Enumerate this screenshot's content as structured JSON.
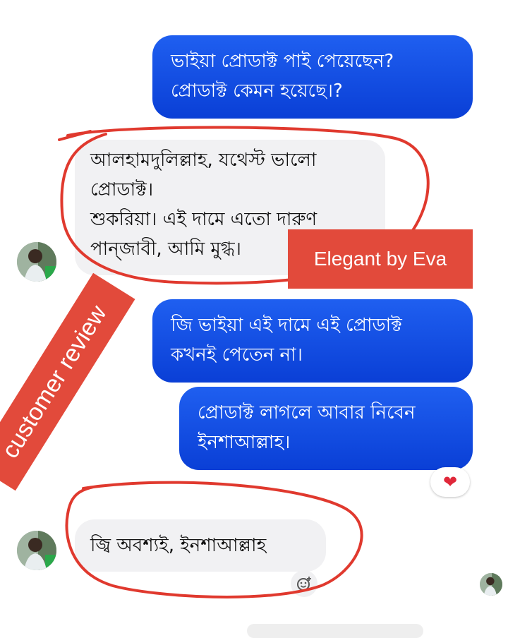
{
  "messages": [
    {
      "id": "m1",
      "side": "out",
      "lines": [
        "ভাইয়া প্রোডাক্ট পাই পেয়েছেন?",
        "প্রোডাক্ট কেমন হয়েছে।?"
      ]
    },
    {
      "id": "m2",
      "side": "in",
      "lines": [
        "আলহামদুলিল্লাহ, যথেস্ট ভালো",
        "প্রোডাক্ট।",
        "শুকরিয়া। এই দামে এতো দারুণ",
        "পান্জাবী, আমি মুগ্ধ।"
      ]
    },
    {
      "id": "m3",
      "side": "out",
      "lines": [
        "জি ভাইয়া এই দামে এই প্রোডাক্ট",
        "কখনই পেতেন না।"
      ]
    },
    {
      "id": "m4",
      "side": "out",
      "lines": [
        "প্রোডাক্ট লাগলে আবার নিবেন",
        "ইনশাআল্লাহ।"
      ]
    },
    {
      "id": "m5",
      "side": "in",
      "lines": [
        "জ্বি অবশ্যই, ইনশাআল্লাহ"
      ]
    }
  ],
  "annotations": {
    "brand_tag": "Elegant by Eva",
    "review_tag": "customer review"
  },
  "reactions": {
    "heart": "❤",
    "add_reaction_icon": "add-reaction-icon"
  },
  "colors": {
    "outgoing": "#0a3fd6",
    "incoming": "#f1f1f3",
    "tag": "#e24a3b",
    "ring": "#e0392e"
  }
}
